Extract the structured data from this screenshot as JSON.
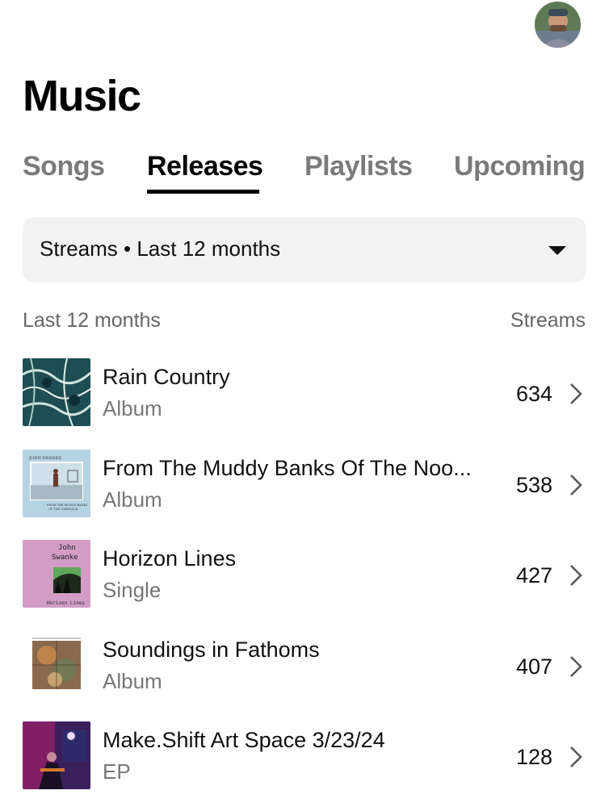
{
  "header": {
    "title": "Music",
    "avatar_icon": "user-avatar"
  },
  "tabs": [
    {
      "label": "Songs",
      "active": false
    },
    {
      "label": "Releases",
      "active": true
    },
    {
      "label": "Playlists",
      "active": false
    },
    {
      "label": "Upcoming",
      "active": false
    }
  ],
  "filter": {
    "selected": "Streams • Last 12 months",
    "icon": "caret-down-icon"
  },
  "list_header": {
    "period": "Last 12 months",
    "metric": "Streams"
  },
  "releases": [
    {
      "title": "Rain Country",
      "type": "Album",
      "streams": "634"
    },
    {
      "title": "From The Muddy Banks Of The Noo...",
      "type": "Album",
      "streams": "538",
      "cover_text": [
        "JOHN SWANKE",
        "FROM THE MUDDY BANKS",
        "OF THE NISHNAUK"
      ]
    },
    {
      "title": "Horizon Lines",
      "type": "Single",
      "streams": "427",
      "cover_text": [
        "John",
        "Swanke",
        "Horizon Lines"
      ]
    },
    {
      "title": "Soundings in Fathoms",
      "type": "Album",
      "streams": "407"
    },
    {
      "title": "Make.Shift Art Space 3/23/24",
      "type": "EP",
      "streams": "128"
    }
  ],
  "colors": {
    "accent": "#000000",
    "muted": "#7a7a7a",
    "filter_bg": "#f2f2f2"
  }
}
